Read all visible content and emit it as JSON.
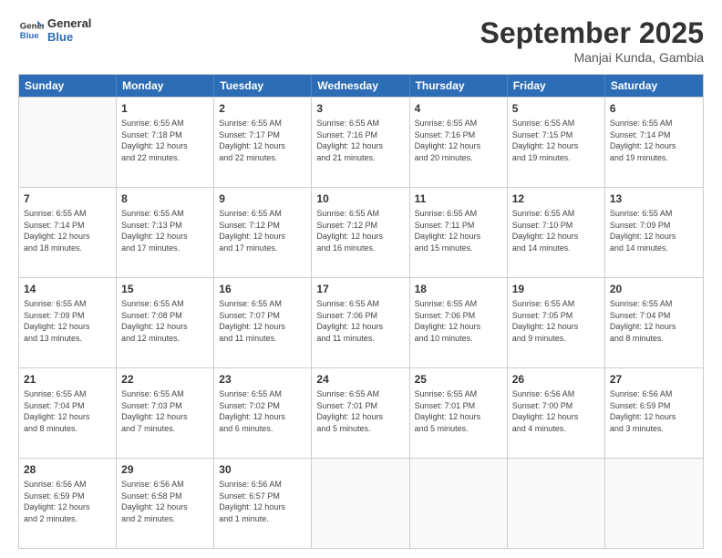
{
  "logo": {
    "line1": "General",
    "line2": "Blue"
  },
  "title": "September 2025",
  "subtitle": "Manjai Kunda, Gambia",
  "header_days": [
    "Sunday",
    "Monday",
    "Tuesday",
    "Wednesday",
    "Thursday",
    "Friday",
    "Saturday"
  ],
  "rows": [
    [
      {
        "day": "",
        "info": ""
      },
      {
        "day": "1",
        "info": "Sunrise: 6:55 AM\nSunset: 7:18 PM\nDaylight: 12 hours\nand 22 minutes."
      },
      {
        "day": "2",
        "info": "Sunrise: 6:55 AM\nSunset: 7:17 PM\nDaylight: 12 hours\nand 22 minutes."
      },
      {
        "day": "3",
        "info": "Sunrise: 6:55 AM\nSunset: 7:16 PM\nDaylight: 12 hours\nand 21 minutes."
      },
      {
        "day": "4",
        "info": "Sunrise: 6:55 AM\nSunset: 7:16 PM\nDaylight: 12 hours\nand 20 minutes."
      },
      {
        "day": "5",
        "info": "Sunrise: 6:55 AM\nSunset: 7:15 PM\nDaylight: 12 hours\nand 19 minutes."
      },
      {
        "day": "6",
        "info": "Sunrise: 6:55 AM\nSunset: 7:14 PM\nDaylight: 12 hours\nand 19 minutes."
      }
    ],
    [
      {
        "day": "7",
        "info": "Sunrise: 6:55 AM\nSunset: 7:14 PM\nDaylight: 12 hours\nand 18 minutes."
      },
      {
        "day": "8",
        "info": "Sunrise: 6:55 AM\nSunset: 7:13 PM\nDaylight: 12 hours\nand 17 minutes."
      },
      {
        "day": "9",
        "info": "Sunrise: 6:55 AM\nSunset: 7:12 PM\nDaylight: 12 hours\nand 17 minutes."
      },
      {
        "day": "10",
        "info": "Sunrise: 6:55 AM\nSunset: 7:12 PM\nDaylight: 12 hours\nand 16 minutes."
      },
      {
        "day": "11",
        "info": "Sunrise: 6:55 AM\nSunset: 7:11 PM\nDaylight: 12 hours\nand 15 minutes."
      },
      {
        "day": "12",
        "info": "Sunrise: 6:55 AM\nSunset: 7:10 PM\nDaylight: 12 hours\nand 14 minutes."
      },
      {
        "day": "13",
        "info": "Sunrise: 6:55 AM\nSunset: 7:09 PM\nDaylight: 12 hours\nand 14 minutes."
      }
    ],
    [
      {
        "day": "14",
        "info": "Sunrise: 6:55 AM\nSunset: 7:09 PM\nDaylight: 12 hours\nand 13 minutes."
      },
      {
        "day": "15",
        "info": "Sunrise: 6:55 AM\nSunset: 7:08 PM\nDaylight: 12 hours\nand 12 minutes."
      },
      {
        "day": "16",
        "info": "Sunrise: 6:55 AM\nSunset: 7:07 PM\nDaylight: 12 hours\nand 11 minutes."
      },
      {
        "day": "17",
        "info": "Sunrise: 6:55 AM\nSunset: 7:06 PM\nDaylight: 12 hours\nand 11 minutes."
      },
      {
        "day": "18",
        "info": "Sunrise: 6:55 AM\nSunset: 7:06 PM\nDaylight: 12 hours\nand 10 minutes."
      },
      {
        "day": "19",
        "info": "Sunrise: 6:55 AM\nSunset: 7:05 PM\nDaylight: 12 hours\nand 9 minutes."
      },
      {
        "day": "20",
        "info": "Sunrise: 6:55 AM\nSunset: 7:04 PM\nDaylight: 12 hours\nand 8 minutes."
      }
    ],
    [
      {
        "day": "21",
        "info": "Sunrise: 6:55 AM\nSunset: 7:04 PM\nDaylight: 12 hours\nand 8 minutes."
      },
      {
        "day": "22",
        "info": "Sunrise: 6:55 AM\nSunset: 7:03 PM\nDaylight: 12 hours\nand 7 minutes."
      },
      {
        "day": "23",
        "info": "Sunrise: 6:55 AM\nSunset: 7:02 PM\nDaylight: 12 hours\nand 6 minutes."
      },
      {
        "day": "24",
        "info": "Sunrise: 6:55 AM\nSunset: 7:01 PM\nDaylight: 12 hours\nand 5 minutes."
      },
      {
        "day": "25",
        "info": "Sunrise: 6:55 AM\nSunset: 7:01 PM\nDaylight: 12 hours\nand 5 minutes."
      },
      {
        "day": "26",
        "info": "Sunrise: 6:56 AM\nSunset: 7:00 PM\nDaylight: 12 hours\nand 4 minutes."
      },
      {
        "day": "27",
        "info": "Sunrise: 6:56 AM\nSunset: 6:59 PM\nDaylight: 12 hours\nand 3 minutes."
      }
    ],
    [
      {
        "day": "28",
        "info": "Sunrise: 6:56 AM\nSunset: 6:59 PM\nDaylight: 12 hours\nand 2 minutes."
      },
      {
        "day": "29",
        "info": "Sunrise: 6:56 AM\nSunset: 6:58 PM\nDaylight: 12 hours\nand 2 minutes."
      },
      {
        "day": "30",
        "info": "Sunrise: 6:56 AM\nSunset: 6:57 PM\nDaylight: 12 hours\nand 1 minute."
      },
      {
        "day": "",
        "info": ""
      },
      {
        "day": "",
        "info": ""
      },
      {
        "day": "",
        "info": ""
      },
      {
        "day": "",
        "info": ""
      }
    ]
  ]
}
